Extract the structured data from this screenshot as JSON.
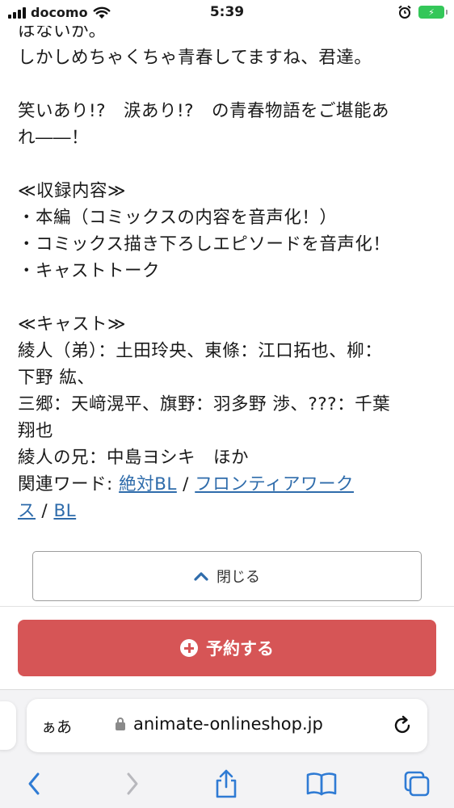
{
  "status_bar": {
    "carrier": "docomo",
    "time": "5:39"
  },
  "description": {
    "line1": "はないか。",
    "line2": "しかしめちゃくちゃ青春してますね、君達。",
    "line3": "笑いあり!?　涙あり!?　の青春物語をご堪能あ",
    "line4": "れ――！",
    "line5": "≪収録内容≫",
    "line6": "・本編（コミックスの内容を音声化！）",
    "line7": "・コミックス描き下ろしエピソードを音声化！",
    "line8": "・キャストトーク",
    "line9": "≪キャスト≫",
    "line10": "綾人（弟）：土田玲央、東條：江口拓也、柳：",
    "line11": "下野 紘、",
    "line12": "三郷：天﨑滉平、旗野：羽多野 渉、???：千葉",
    "line13": "翔也",
    "line14": "綾人の兄：中島ヨシキ　ほか",
    "related_label": "関連ワード: ",
    "links": [
      "絶対BL",
      "フロンティアワーク",
      "ス",
      "BL"
    ],
    "separator": " / "
  },
  "close_button": {
    "label": "閉じる",
    "icon": "chevron-up-icon"
  },
  "reserve_button": {
    "label": "予約する",
    "icon": "plus-circle-icon",
    "color": "#d65556"
  },
  "browser": {
    "aa_label": "ぁあ",
    "url": "animate-onlineshop.jp"
  },
  "colors": {
    "link": "#2f6cab",
    "accent_blue": "#2f7bd4",
    "battery": "#34c759"
  }
}
